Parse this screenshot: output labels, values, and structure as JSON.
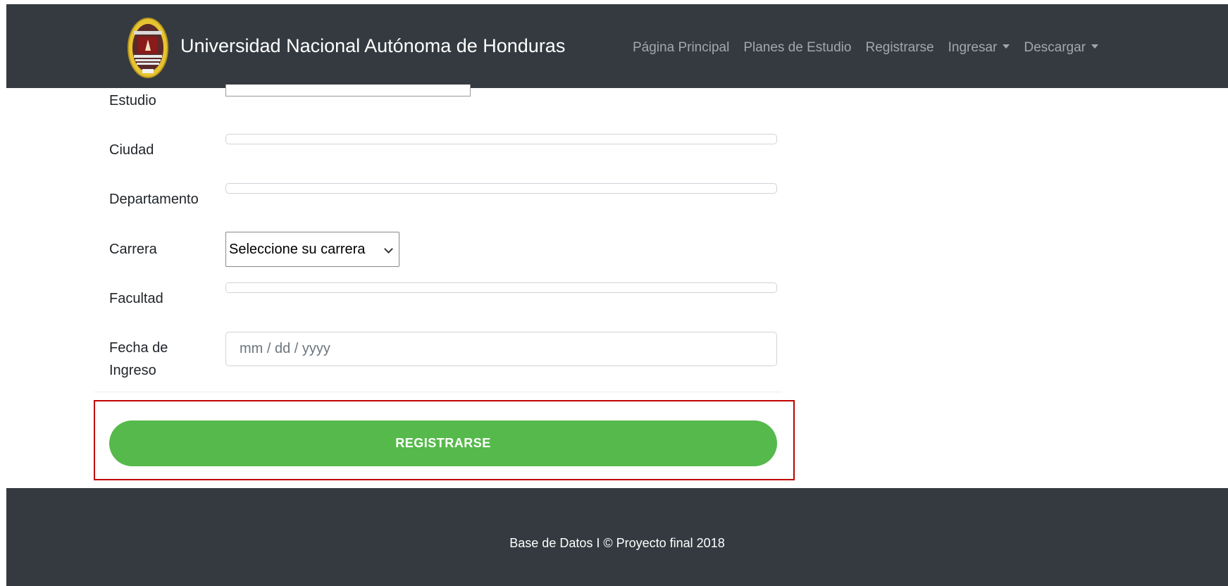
{
  "navbar": {
    "brand": "Universidad Nacional Autónoma de Honduras",
    "links": [
      "Página Principal",
      "Planes de Estudio",
      "Registrarse"
    ],
    "dropdowns": [
      "Ingresar",
      "Descargar"
    ]
  },
  "form": {
    "labels": {
      "estudio": "Estudio",
      "ciudad": "Ciudad",
      "departamento": "Departamento",
      "carrera": "Carrera",
      "facultad": "Facultad",
      "fecha_line1": "Fecha de",
      "fecha_line2": "Ingreso"
    },
    "carrera_select": "Seleccione su carrera",
    "fecha_placeholder": "mm / dd / yyyy",
    "submit_label": "REGISTRARSE"
  },
  "footer": {
    "text": "Base de Datos I © Proyecto final 2018"
  },
  "colors": {
    "navbar_bg": "#343a40",
    "button_green": "#56b94b",
    "highlight_red": "#c00000"
  }
}
